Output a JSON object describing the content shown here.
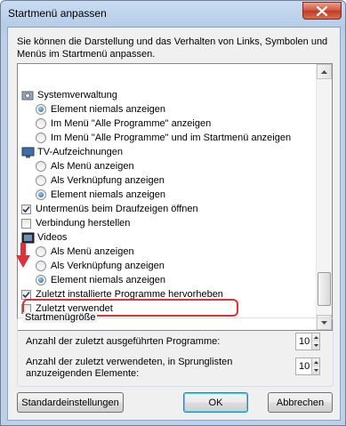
{
  "window": {
    "title": "Startmenü anpassen",
    "description": "Sie können die Darstellung und das Verhalten von Links, Symbolen und Menüs im Startmenü anpassen."
  },
  "list": {
    "items": [
      {
        "kind": "category",
        "icon": "system-admin-icon",
        "label": "Systemverwaltung"
      },
      {
        "kind": "radio",
        "label": "Element niemals anzeigen",
        "checked": true
      },
      {
        "kind": "radio",
        "label": "Im Menü \"Alle Programme\" anzeigen",
        "checked": false
      },
      {
        "kind": "radio",
        "label": "Im Menü \"Alle Programme\" und im Startmenü anzeigen",
        "checked": false
      },
      {
        "kind": "category",
        "icon": "tv-icon",
        "label": "TV-Aufzeichnungen"
      },
      {
        "kind": "radio",
        "label": "Als Menü anzeigen",
        "checked": false
      },
      {
        "kind": "radio",
        "label": "Als Verknüpfung anzeigen",
        "checked": false
      },
      {
        "kind": "radio",
        "label": "Element niemals anzeigen",
        "checked": true
      },
      {
        "kind": "checkbox",
        "label": "Untermenüs beim Draufzeigen öffnen",
        "checked": true
      },
      {
        "kind": "checkbox",
        "label": "Verbindung herstellen",
        "checked": false
      },
      {
        "kind": "category",
        "icon": "videos-icon",
        "label": "Videos"
      },
      {
        "kind": "radio",
        "label": "Als Menü anzeigen",
        "checked": false
      },
      {
        "kind": "radio",
        "label": "Als Verknüpfung anzeigen",
        "checked": false
      },
      {
        "kind": "radio",
        "label": "Element niemals anzeigen",
        "checked": true
      },
      {
        "kind": "checkbox",
        "label": "Zuletzt installierte Programme hervorheben",
        "checked": true
      },
      {
        "kind": "checkbox",
        "label": "Zuletzt verwendet",
        "checked": false
      }
    ]
  },
  "size_group": {
    "title": "Startmenügröße",
    "recent_programs_label": "Anzahl der zuletzt ausgeführten Programme:",
    "recent_programs_value": "10",
    "jumplist_label_line1": "Anzahl der zuletzt verwendeten, in Sprunglisten",
    "jumplist_label_line2": "anzuzeigenden Elemente:",
    "jumplist_value": "10"
  },
  "buttons": {
    "defaults": "Standardeinstellungen",
    "ok": "OK",
    "cancel": "Abbrechen"
  },
  "colors": {
    "highlight_border": "#e0313b",
    "arrow": "#e0313b"
  }
}
